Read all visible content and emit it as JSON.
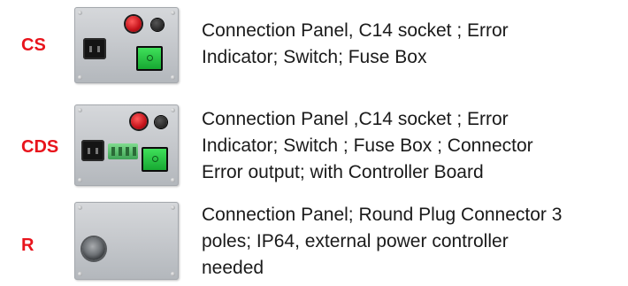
{
  "rows": [
    {
      "code": "CS",
      "lines": [
        "Connection Panel, C14 socket ; Error",
        "Indicator; Switch; Fuse Box"
      ]
    },
    {
      "code": "CDS",
      "lines": [
        "Connection Panel ,C14 socket ; Error",
        "Indicator; Switch ; Fuse Box ; Connector",
        "Error output; with Controller Board"
      ]
    },
    {
      "code": "R",
      "lines": [
        "Connection Panel; Round Plug Connector 3",
        "poles; IP64, external power controller",
        "needed"
      ]
    }
  ],
  "colors": {
    "code_red": "#e8141c",
    "panel_grey": "#c5c8cc",
    "switch_green": "#2ec04a",
    "indicator_red": "#d41820"
  }
}
